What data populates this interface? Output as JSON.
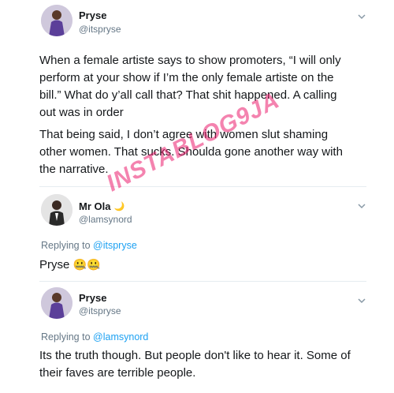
{
  "tweet1": {
    "name": "Pryse",
    "handle": "@itspryse",
    "paragraph1": "When a female artiste says to show promoters, “I will only perform at your show if I’m the only female artiste on the bill.” What do y’all call that? That shit happened. A calling out was in order",
    "paragraph2": "That being said, I don’t agree with women slut shaming other women. That sucks. Shoulda gone another way with the narrative."
  },
  "tweet2": {
    "name": "Mr Ola",
    "name_emoji": "🌙",
    "handle": "@lamsynord",
    "replying_label": "Replying to",
    "replying_mention": "@itspryse",
    "text": "Pryse",
    "emojis": "🤐🤐"
  },
  "tweet3": {
    "name": "Pryse",
    "handle": "@itspryse",
    "replying_label": "Replying to",
    "replying_mention": "@lamsynord",
    "text": "Its the truth though. But people don't like to hear it. Some of their faves are terrible people."
  },
  "watermark": "INSTABLOG9JA",
  "icons": {
    "more": "chevron-down-icon",
    "avatar": "avatar"
  },
  "colors": {
    "handle": "#657786",
    "mention": "#1da1f2",
    "watermark": "#eb1e6e"
  }
}
